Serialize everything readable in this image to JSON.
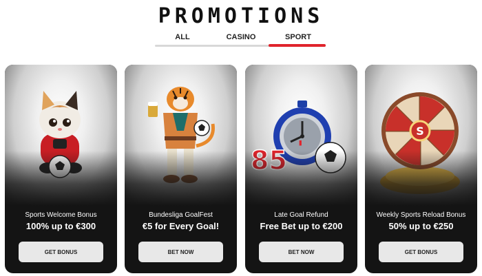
{
  "page": {
    "title": "PROMOTIONS"
  },
  "tabs": [
    {
      "label": "ALL",
      "active": false
    },
    {
      "label": "CASINO",
      "active": false
    },
    {
      "label": "SPORT",
      "active": true
    }
  ],
  "colors": {
    "accent": "#e0242c",
    "card_bg": "#141414",
    "button_bg": "#e8e8e8"
  },
  "cards": [
    {
      "art": "kitten-football-illustration",
      "subtitle": "Sports Welcome Bonus",
      "headline": "100% up to €300",
      "button": "GET BONUS"
    },
    {
      "art": "tiger-with-beer-illustration",
      "subtitle": "Bundesliga GoalFest",
      "headline": "€5 for Every Goal!",
      "button": "BET NOW"
    },
    {
      "art": "stopwatch-85-illustration",
      "art_text": "85",
      "subtitle": "Late Goal Refund",
      "headline": "Free Bet up to €200",
      "button": "BET NOW"
    },
    {
      "art": "prize-wheel-coins-illustration",
      "art_text": "S",
      "subtitle": "Weekly Sports Reload Bonus",
      "headline": "50% up to €250",
      "button": "GET BONUS"
    }
  ]
}
